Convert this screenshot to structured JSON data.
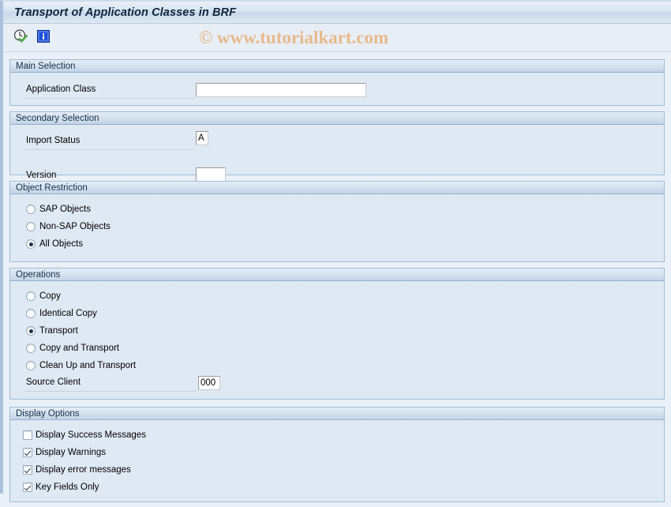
{
  "window": {
    "title": "Transport of Application Classes in BRF"
  },
  "toolbar": {
    "buttons": [
      {
        "name": "execute-button",
        "icon": "clock-check-icon",
        "tooltip": "Execute (F8)"
      },
      {
        "name": "info-button",
        "icon": "information-icon",
        "tooltip": "Information"
      }
    ]
  },
  "watermark": {
    "text": "© www.tutorialkart.com",
    "color": "#e8b98b"
  },
  "sections": {
    "main_selection": {
      "title": "Main Selection",
      "fields": [
        {
          "label": "Application Class",
          "value": "",
          "placeholder": ""
        }
      ]
    },
    "secondary_selection": {
      "title": "Secondary Selection",
      "fields": [
        {
          "label": "Import Status",
          "value": "A",
          "placeholder": ""
        },
        {
          "label": "Version",
          "value": "",
          "placeholder": ""
        }
      ]
    },
    "object_restriction": {
      "title": "Object Restriction",
      "options": [
        {
          "label": "SAP Objects",
          "selected": false
        },
        {
          "label": "Non-SAP Objects",
          "selected": false
        },
        {
          "label": "All Objects",
          "selected": true
        }
      ]
    },
    "operations": {
      "title": "Operations",
      "options": [
        {
          "label": "Copy",
          "selected": false
        },
        {
          "label": "Identical Copy",
          "selected": false
        },
        {
          "label": "Transport",
          "selected": true
        },
        {
          "label": "Copy and Transport",
          "selected": false
        },
        {
          "label": "Clean Up and Transport",
          "selected": false
        }
      ],
      "fields": [
        {
          "label": "Source Client",
          "value": "000",
          "placeholder": ""
        }
      ]
    },
    "display_options": {
      "title": "Display Options",
      "checkboxes": [
        {
          "label": "Display Success Messages",
          "checked": false
        },
        {
          "label": "Display Warnings",
          "checked": true
        },
        {
          "label": "Display error messages",
          "checked": true
        },
        {
          "label": "Key Fields Only",
          "checked": true
        }
      ]
    }
  }
}
